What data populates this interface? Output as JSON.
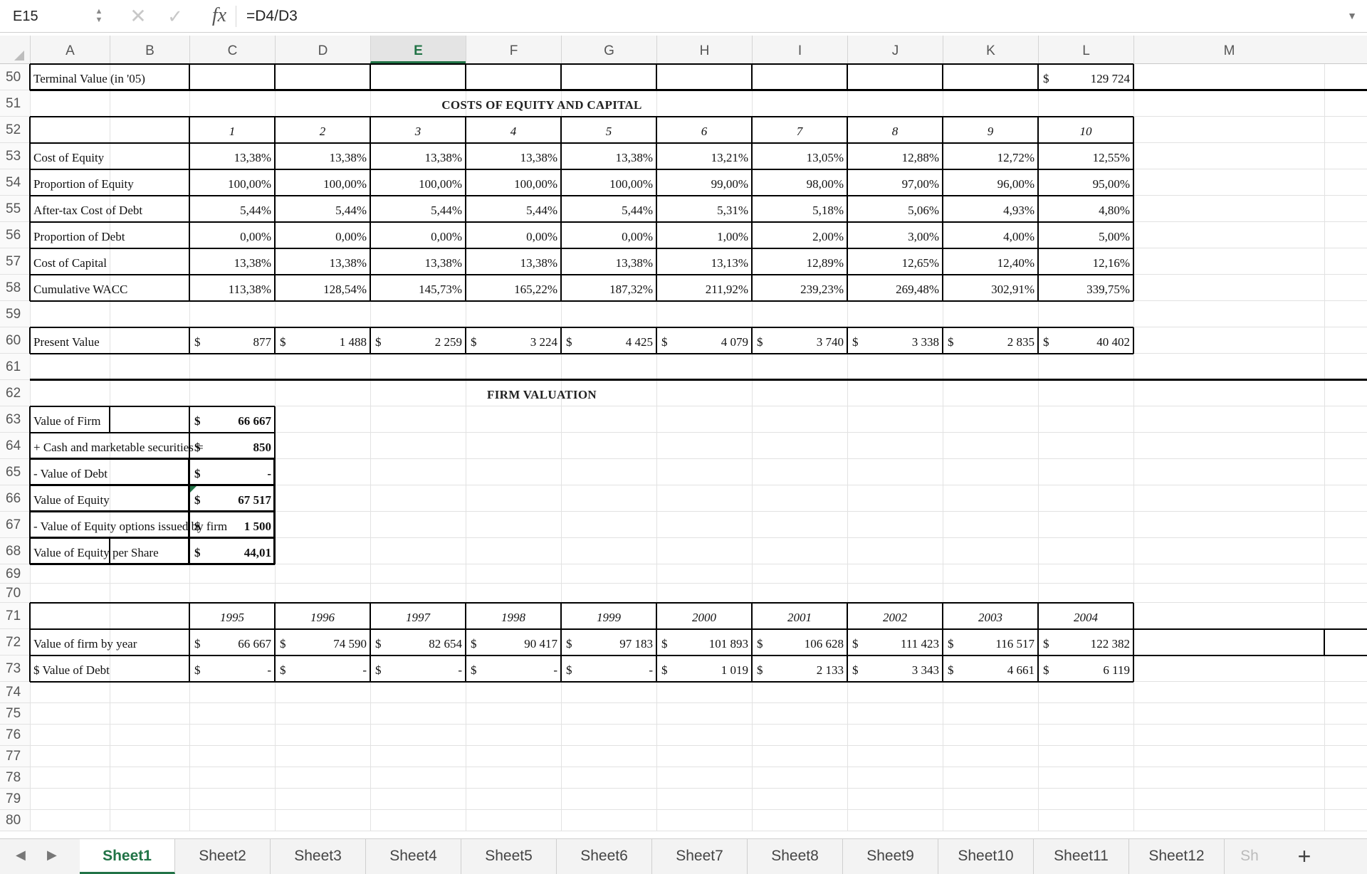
{
  "formula_bar": {
    "name_box": "E15",
    "formula": "=D4/D3",
    "icons": [
      "stepper-icon",
      "cancel-icon",
      "confirm-icon",
      "fx-icon",
      "expand-icon"
    ]
  },
  "selected_column": "E",
  "columns": [
    "A",
    "B",
    "C",
    "D",
    "E",
    "F",
    "G",
    "H",
    "I",
    "J",
    "K",
    "L",
    "M"
  ],
  "rows": [
    "50",
    "51",
    "52",
    "53",
    "54",
    "55",
    "56",
    "57",
    "58",
    "59",
    "60",
    "61",
    "62",
    "63",
    "64",
    "65",
    "66",
    "67",
    "68",
    "69",
    "70",
    "71",
    "72",
    "73",
    "74",
    "75",
    "76",
    "77",
    "78",
    "79",
    "80"
  ],
  "r50": {
    "label": "Terminal Value (in '05)",
    "currency": "$",
    "value": "129 724"
  },
  "section_costs": "COSTS OF EQUITY AND CAPITAL",
  "section_firm": "FIRM VALUATION",
  "years_index": [
    "1",
    "2",
    "3",
    "4",
    "5",
    "6",
    "7",
    "8",
    "9",
    "10"
  ],
  "cost_rows": [
    {
      "label": "Cost of Equity",
      "values": [
        "13,38%",
        "13,38%",
        "13,38%",
        "13,38%",
        "13,38%",
        "13,21%",
        "13,05%",
        "12,88%",
        "12,72%",
        "12,55%"
      ]
    },
    {
      "label": "Proportion of Equity",
      "values": [
        "100,00%",
        "100,00%",
        "100,00%",
        "100,00%",
        "100,00%",
        "99,00%",
        "98,00%",
        "97,00%",
        "96,00%",
        "95,00%"
      ]
    },
    {
      "label": "After-tax Cost of Debt",
      "values": [
        "5,44%",
        "5,44%",
        "5,44%",
        "5,44%",
        "5,44%",
        "5,31%",
        "5,18%",
        "5,06%",
        "4,93%",
        "4,80%"
      ]
    },
    {
      "label": "Proportion of Debt",
      "values": [
        "0,00%",
        "0,00%",
        "0,00%",
        "0,00%",
        "0,00%",
        "1,00%",
        "2,00%",
        "3,00%",
        "4,00%",
        "5,00%"
      ]
    },
    {
      "label": "Cost of Capital",
      "values": [
        "13,38%",
        "13,38%",
        "13,38%",
        "13,38%",
        "13,38%",
        "13,13%",
        "12,89%",
        "12,65%",
        "12,40%",
        "12,16%"
      ]
    },
    {
      "label": "Cumulative WACC",
      "values": [
        "113,38%",
        "128,54%",
        "145,73%",
        "165,22%",
        "187,32%",
        "211,92%",
        "239,23%",
        "269,48%",
        "302,91%",
        "339,75%"
      ]
    }
  ],
  "present_value": {
    "label": "Present Value",
    "currency": "$",
    "values": [
      "877",
      "1 488",
      "2 259",
      "3 224",
      "4 425",
      "4 079",
      "3 740",
      "3 338",
      "2 835",
      "40 402"
    ]
  },
  "valuation": [
    {
      "label": "Value of Firm",
      "currency": "$",
      "value": "66 667"
    },
    {
      "label": "+ Cash and marketable securities =",
      "currency": "$",
      "value": "850"
    },
    {
      "label": "- Value of Debt",
      "currency": "$",
      "value": "-"
    },
    {
      "label": "Value of Equity",
      "currency": "$",
      "value": "67 517"
    },
    {
      "label": "- Value of Equity options issued by firm",
      "currency": "$",
      "value": "1 500"
    },
    {
      "label": "Value of Equity per Share",
      "currency": "$",
      "value": "44,01"
    }
  ],
  "calendar_years": [
    "1995",
    "1996",
    "1997",
    "1998",
    "1999",
    "2000",
    "2001",
    "2002",
    "2003",
    "2004"
  ],
  "by_year": [
    {
      "label": "Value of firm by year",
      "currency": "$",
      "values": [
        "66 667",
        "74 590",
        "82 654",
        "90 417",
        "97 183",
        "101 893",
        "106 628",
        "111 423",
        "116 517",
        "122 382"
      ]
    },
    {
      "label": "$ Value of Debt",
      "currency": "$",
      "values": [
        "-",
        "-",
        "-",
        "-",
        "-",
        "1 019",
        "2 133",
        "3 343",
        "4 661",
        "6 119"
      ]
    }
  ],
  "sheet_tabs": [
    "Sheet1",
    "Sheet2",
    "Sheet3",
    "Sheet4",
    "Sheet5",
    "Sheet6",
    "Sheet7",
    "Sheet8",
    "Sheet9",
    "Sheet10",
    "Sheet11",
    "Sheet12",
    "Sh"
  ],
  "active_sheet": "Sheet1",
  "add_sheet_label": "+",
  "nav": {
    "prev": "◀",
    "next": "▶"
  },
  "colors": {
    "accent": "#217346",
    "border": "#000000",
    "gridline": "#e2e2e2"
  }
}
